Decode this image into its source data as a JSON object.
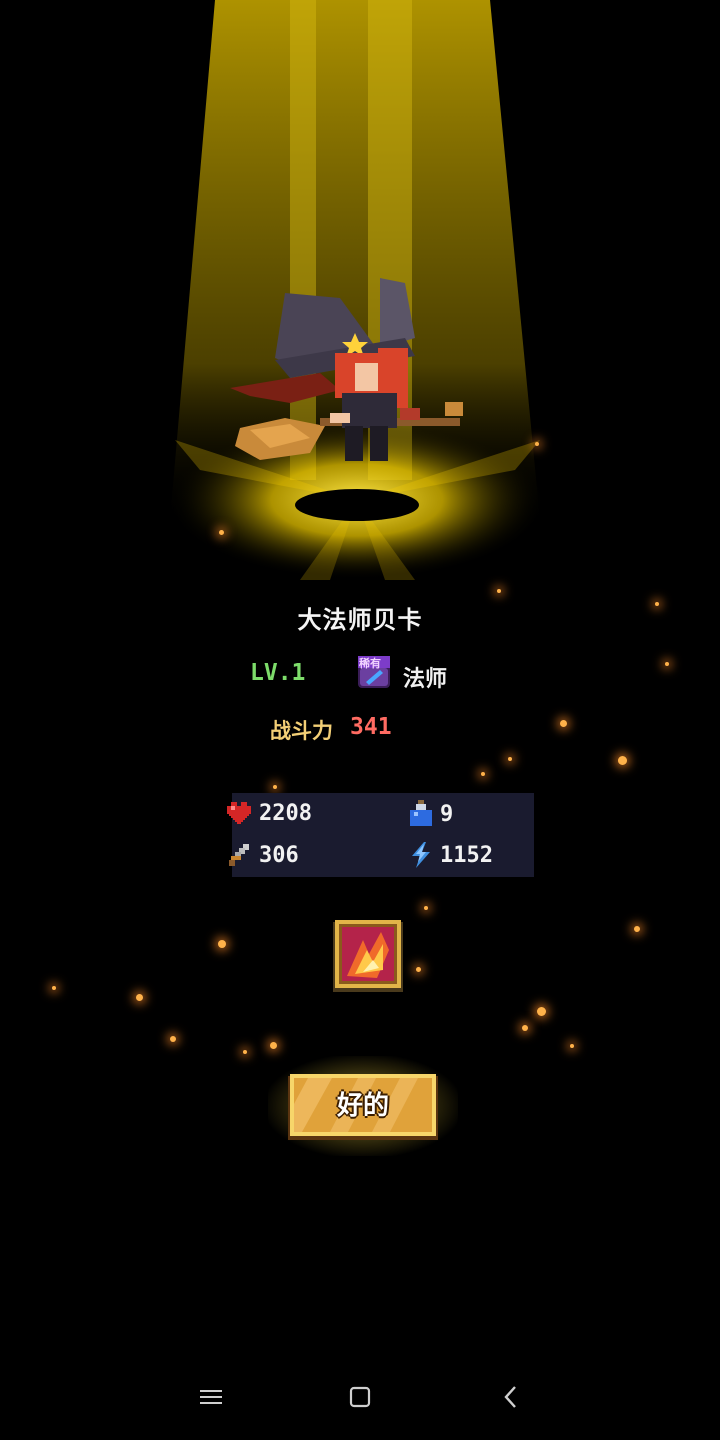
{
  "hero": {
    "name": "大法师贝卡",
    "level": "LV.1",
    "rarity_badge": "稀有",
    "class": "法师",
    "power_label": "战斗力",
    "power_value": "341"
  },
  "stats": [
    {
      "icon": "heart-icon",
      "value": "2208"
    },
    {
      "icon": "potion-icon",
      "value": "9"
    },
    {
      "icon": "sword-icon",
      "value": "306"
    },
    {
      "icon": "lightning-icon",
      "value": "1152"
    }
  ],
  "reward_item": {
    "icon": "fire-scroll-icon"
  },
  "confirm_button": {
    "label": "好的"
  },
  "navbar": {
    "menu_icon": "menu-icon",
    "home_icon": "home-square-icon",
    "back_icon": "back-chevron-icon"
  },
  "colors": {
    "beam": "#c9a800",
    "level": "#7ddc6a",
    "power_label": "#f3cf76",
    "power_value": "#ff6b62",
    "panel": "#1a1b2f",
    "button": "#e0a23a"
  }
}
